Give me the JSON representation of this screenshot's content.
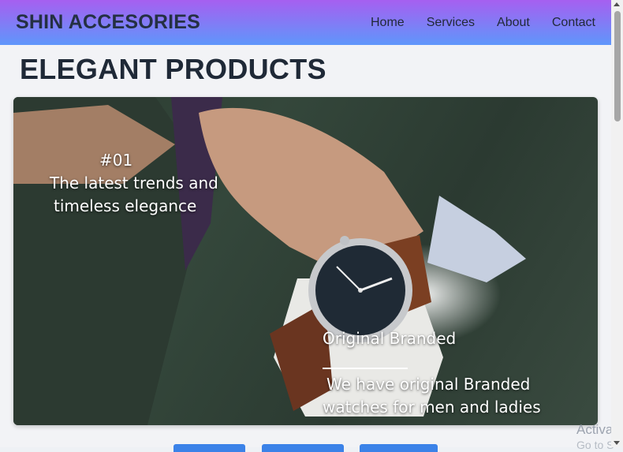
{
  "brand": "SHIN ACCESORIES",
  "nav": {
    "items": [
      "Home",
      "Services",
      "About",
      "Contact"
    ]
  },
  "page_title": "ELEGANT PRODUCTS",
  "hero": {
    "number": "#01",
    "tagline_line1": "The latest trends and",
    "tagline_line2": "timeless elegance",
    "section_title": "Original Branded",
    "description_line1": "We have original Branded",
    "description_line2": "watches for men and ladies"
  },
  "watermark": {
    "line1": "Activat",
    "line2": "Go to S"
  },
  "colors": {
    "navbar_top": "#a65ff0",
    "navbar_bottom": "#5f96fb",
    "button_blue": "#3b82e8"
  }
}
